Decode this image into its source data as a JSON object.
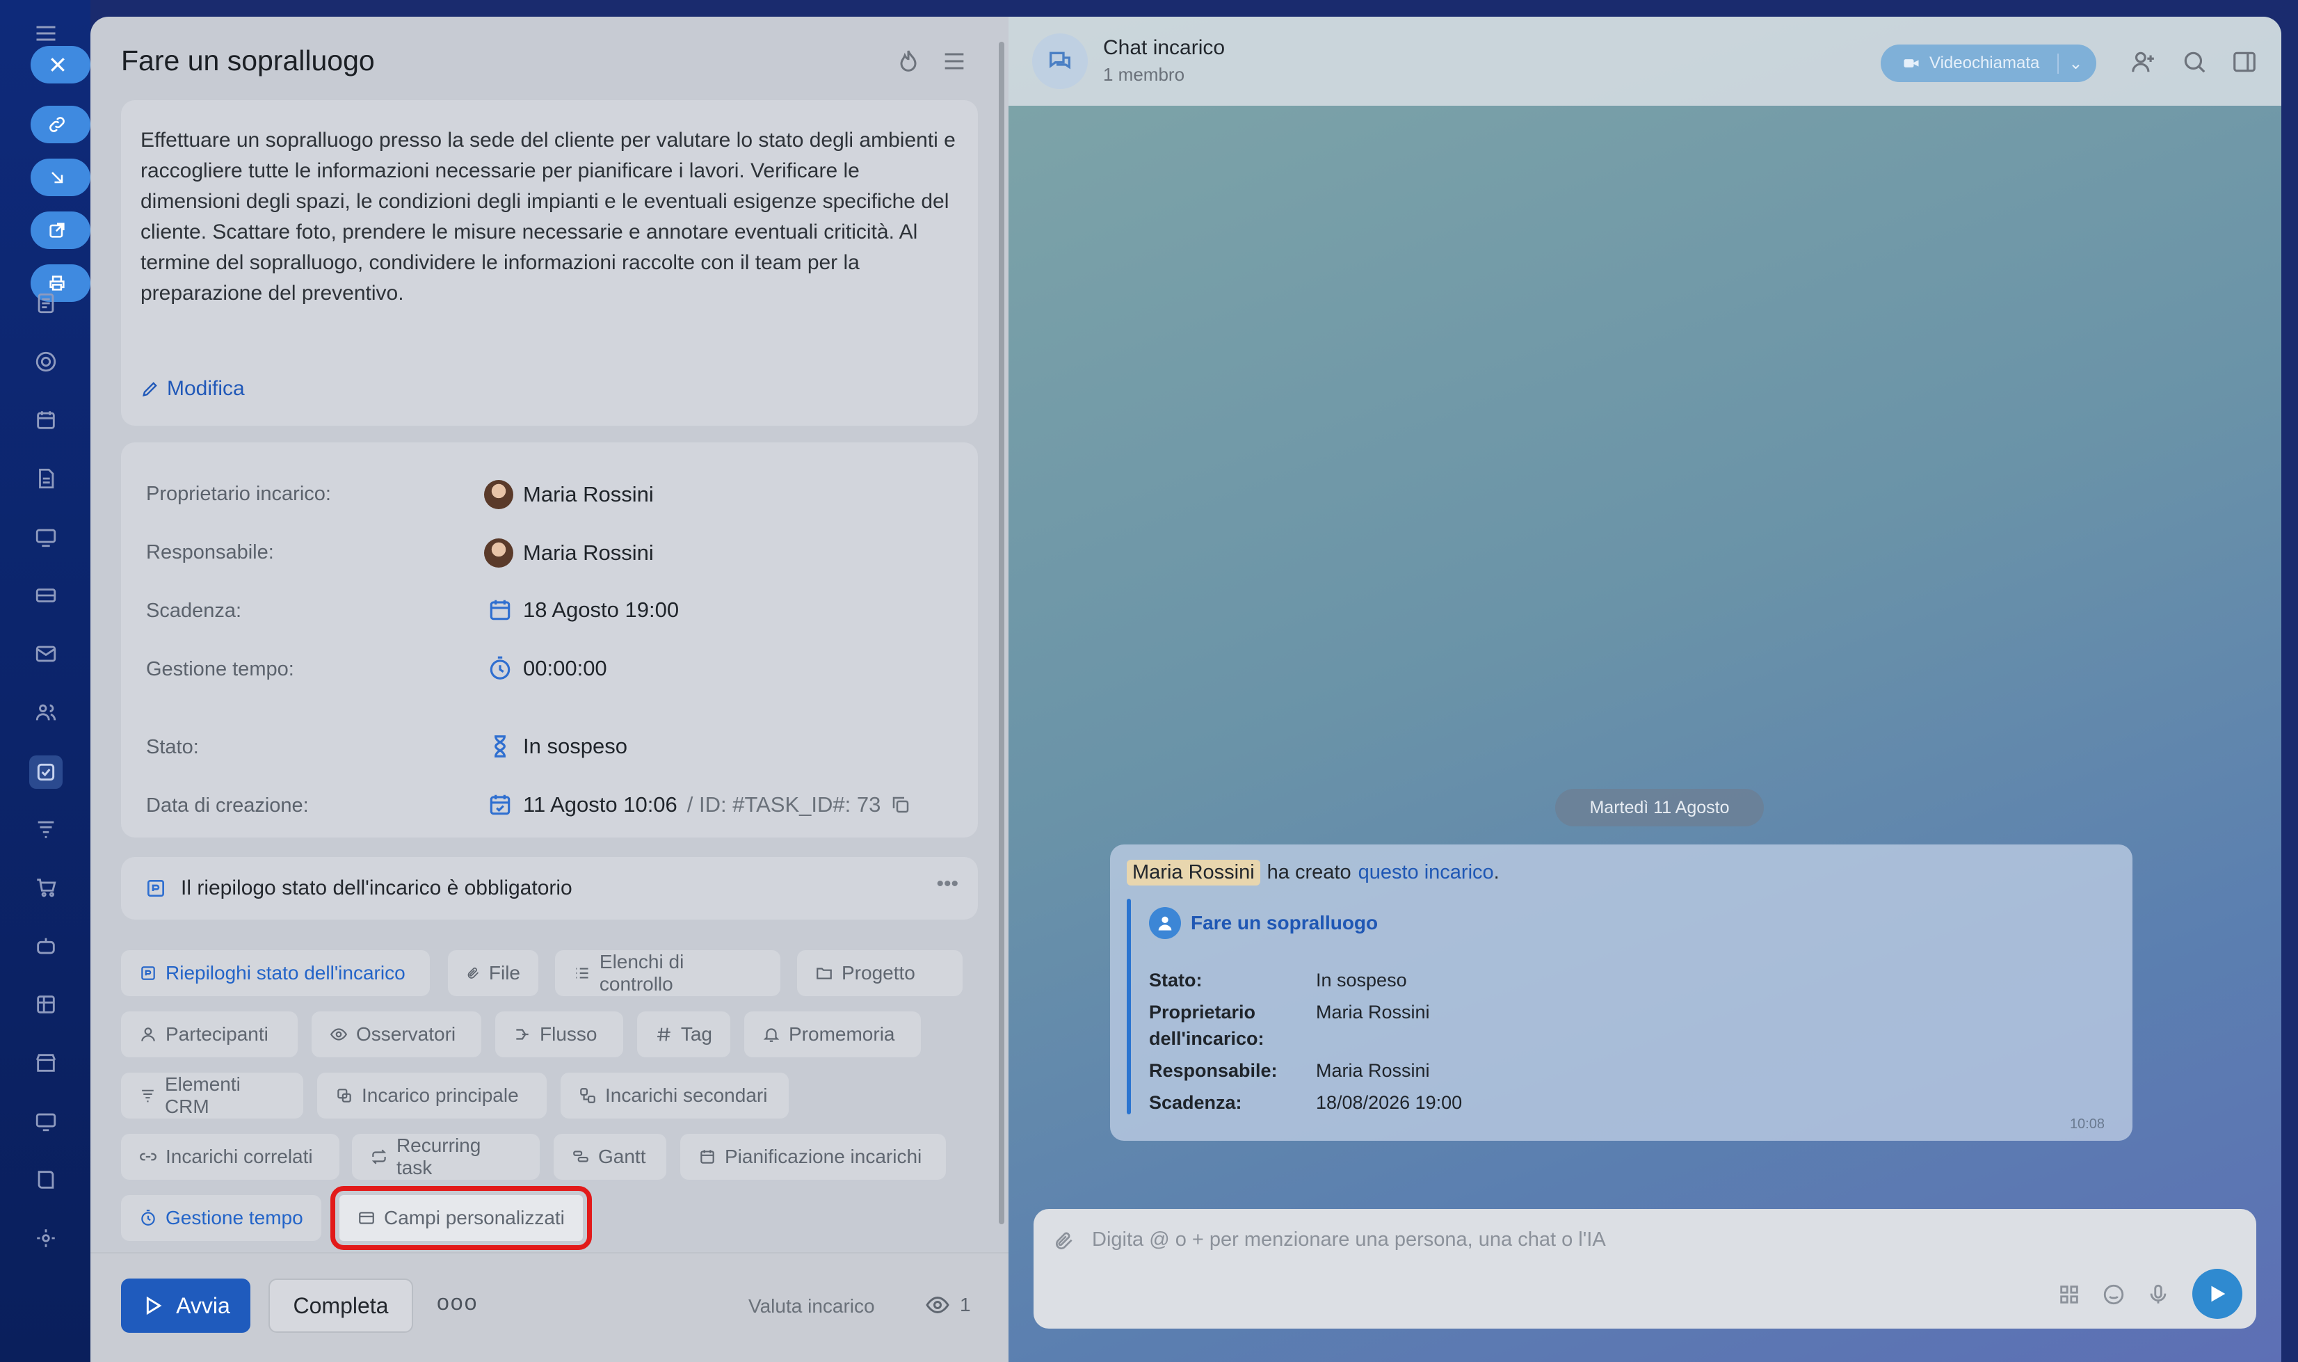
{
  "task": {
    "title": "Fare un sopralluogo",
    "description": "Effettuare un sopralluogo presso la sede del cliente per valutare lo stato degli ambienti e raccogliere tutte le informazioni necessarie per pianificare i lavori. Verificare le dimensioni degli spazi, le condizioni degli impianti e le eventuali esigenze specifiche del cliente. Scattare foto, prendere le misure necessarie e annotare eventuali criticità. Al termine del sopralluogo, condividere le informazioni raccolte con il team per la preparazione del preventivo.",
    "edit_label": "Modifica",
    "fields": {
      "owner_label": "Proprietario incarico:",
      "owner_value": "Maria Rossini",
      "responsible_label": "Responsabile:",
      "responsible_value": "Maria Rossini",
      "deadline_label": "Scadenza:",
      "deadline_value": "18 Agosto 19:00",
      "time_label": "Gestione tempo:",
      "time_value": "00:00:00",
      "status_label": "Stato:",
      "status_value": "In sospeso",
      "created_label": "Data di creazione:",
      "created_value": "11 Agosto 10:06",
      "id_value": "/ ID: #TASK_ID#: 73"
    },
    "summary_required": "Il riepilogo stato dell'incarico è obbligatorio",
    "chips": {
      "c1": "Riepiloghi stato dell'incarico",
      "c2": "File",
      "c3": "Elenchi di controllo",
      "c4": "Progetto",
      "c5": "Partecipanti",
      "c6": "Osservatori",
      "c7": "Flusso",
      "c8": "Tag",
      "c9": "Promemoria",
      "c10": "Elementi CRM",
      "c11": "Incarico principale",
      "c12": "Incarichi secondari",
      "c13": "Incarichi correlati",
      "c14": "Recurring task",
      "c15": "Gantt",
      "c16": "Pianificazione incarichi",
      "c17": "Gestione tempo",
      "c18": "Campi personalizzati"
    },
    "footer": {
      "start": "Avvia",
      "complete": "Completa",
      "rate": "Valuta incarico",
      "views": "1"
    }
  },
  "chat": {
    "title": "Chat incarico",
    "subtitle": "1 membro",
    "video_label": "Videochiamata",
    "date_divider": "Martedì 11 Agosto",
    "message": {
      "author": "Maria Rossini",
      "text": "ha creato",
      "link": "questo incarico",
      "end": ".",
      "task_title": "Fare un sopralluogo",
      "stato_k": "Stato:",
      "stato_v": "In sospeso",
      "prop_k1": "Proprietario",
      "prop_k2": "dell'incarico:",
      "prop_v": "Maria Rossini",
      "resp_k": "Responsabile:",
      "resp_v": "Maria Rossini",
      "scad_k": "Scadenza:",
      "scad_v": "18/08/2026 19:00",
      "time": "10:08"
    },
    "input_placeholder": "Digita @ o + per menzionare una persona, una chat o l'IA"
  }
}
